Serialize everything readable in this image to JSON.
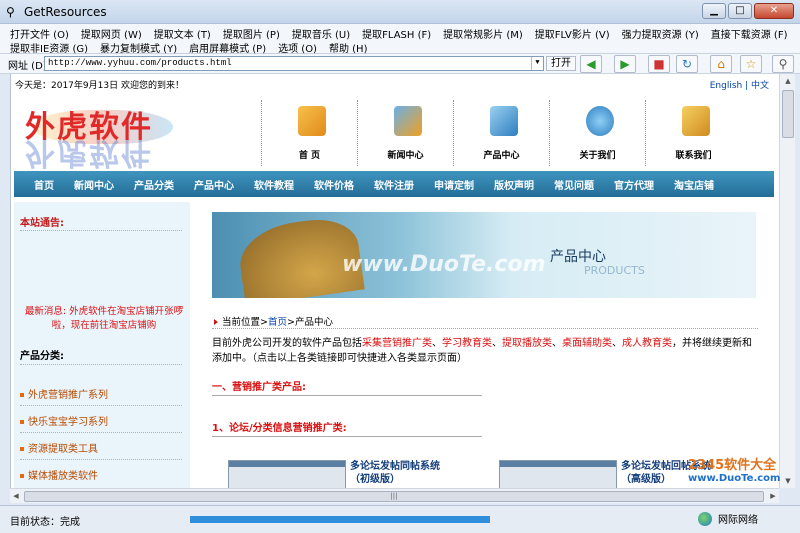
{
  "window": {
    "title": "GetResources"
  },
  "menu": {
    "row1": [
      "打开文件 (O)",
      "提取网页 (W)",
      "提取文本 (T)",
      "提取图片 (P)",
      "提取音乐 (U)",
      "提取FLASH (F)",
      "提取常规影片 (M)",
      "提取FLV影片 (V)",
      "强力提取资源 (Y)",
      "直接下载资源 (F)"
    ],
    "row2": [
      "提取非IE资源 (G)",
      "暴力复制模式 (Y)",
      "启用屏幕模式 (P)",
      "选项 (O)",
      "帮助 (H)"
    ]
  },
  "address": {
    "label": "网址 (D)",
    "url": "http://www.yyhuu.com/products.html",
    "go_label": "打开"
  },
  "page": {
    "greeting": "今天是：2017年9月13日 欢迎您的到来！",
    "lang": "English | 中文",
    "logo_text": "外虎软件",
    "top_nav": [
      {
        "label": "首 页",
        "icon": "home-icon",
        "color": "#f0a530"
      },
      {
        "label": "新闻中心",
        "icon": "news-icon",
        "color": "#3d86c6"
      },
      {
        "label": "产品中心",
        "icon": "computer-icon",
        "color": "#4fa3d6"
      },
      {
        "label": "关于我们",
        "icon": "globe-icon",
        "color": "#47a0d8"
      },
      {
        "label": "联系我们",
        "icon": "people-icon",
        "color": "#e8b23a"
      }
    ],
    "nav": [
      "首页",
      "新闻中心",
      "产品分类",
      "产品中心",
      "软件教程",
      "软件价格",
      "软件注册",
      "申请定制",
      "版权声明",
      "常见问题",
      "官方代理",
      "淘宝店铺"
    ],
    "sidebar": {
      "notice_title": "本站通告:",
      "news": "最新消息: 外虎软件在淘宝店铺开张啰啦，现在前往淘宝店铺购",
      "category_title": "产品分类:",
      "categories": [
        "外虎营销推广系列",
        "快乐宝宝学习系列",
        "资源提取类工具",
        "媒体播放类软件"
      ]
    },
    "banner": {
      "watermark": "www.DuoTe.com",
      "title": "产品中心",
      "subtitle": "PRODUCTS"
    },
    "breadcrumb": {
      "prefix": "当前位置>",
      "home": "首页",
      "sep": ">",
      "current": "产品中心"
    },
    "intro": {
      "lead": "目前外虎公司开发的软件产品包括",
      "links": [
        "采集营销推广类",
        "学习教育类",
        "提取播放类",
        "桌面辅助类",
        "成人教育类"
      ],
      "tail": "，并将继续更新和添加中。（点击以上各类链接即可快捷进入各类显示页面）"
    },
    "section1": "一、营销推广类产品:",
    "section2": "1、论坛/分类信息营销推广类:",
    "products": [
      {
        "name": "多论坛发帖同帖系统",
        "edition": "（初级版）"
      },
      {
        "name": "多论坛发帖回帖系统",
        "edition": "（高级版）"
      }
    ]
  },
  "watermark": {
    "line1": "2345软件大全",
    "line2": "www.DuoTe.com"
  },
  "status": {
    "text": "目前状态：完成",
    "progress_pct": 100,
    "zone": "网际网络"
  }
}
